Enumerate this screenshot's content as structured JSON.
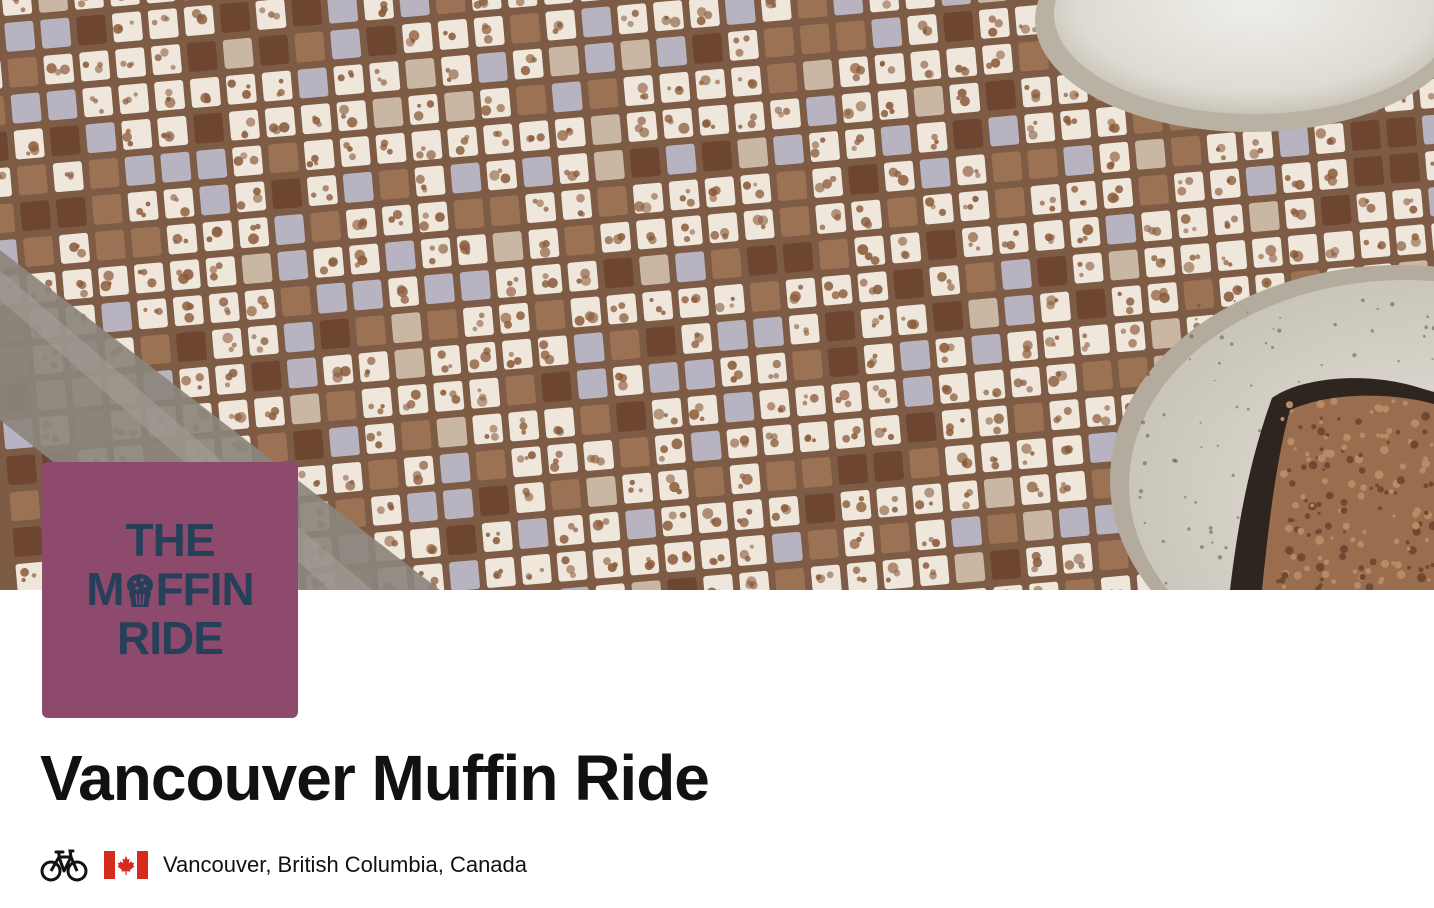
{
  "club": {
    "name": "Vancouver Muffin Ride",
    "location": "Vancouver, British Columbia, Canada",
    "sport_icon": "bicycle-icon",
    "country_flag": "canada-flag-icon"
  },
  "logo": {
    "line1": "THE",
    "line2_start": "M",
    "line2_end": "FFIN",
    "line3": "RIDE",
    "background_color": "#8e4a6c",
    "text_color": "#26405a"
  },
  "cover": {
    "description_icon": "tile-mosaic-photo"
  },
  "colors": {
    "text": "#111111",
    "flag_red": "#d52b1e"
  }
}
